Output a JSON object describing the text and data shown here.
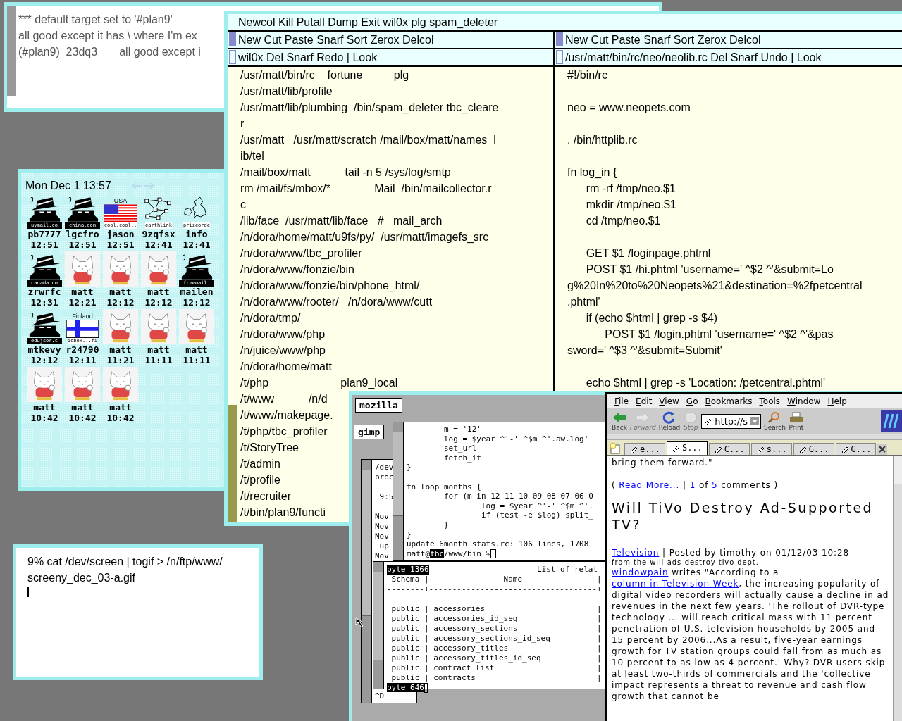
{
  "irc_window": {
    "lines": [
      "*** default target set to '#plan9'",
      "all good except it has \\ where I'm ex",
      "(#plan9)  23dq3       all good except i"
    ]
  },
  "faces_window": {
    "clock": "Mon Dec  1 13:57",
    "faces": [
      {
        "kind": "spy",
        "caption": "uymail.co",
        "name": "pb7777",
        "time": "12:51"
      },
      {
        "kind": "spy",
        "caption": "china.com",
        "name": "lgcfro",
        "time": "12:51"
      },
      {
        "kind": "flag_usa",
        "country": "USA",
        "caption": "cool.cool..",
        "name": "jason",
        "time": "12:51"
      },
      {
        "kind": "network",
        "caption": "earthlink",
        "name": "9zqfsx",
        "time": "12:41"
      },
      {
        "kind": "map",
        "caption": "prizeorde",
        "name": "info",
        "time": "12:41"
      },
      {
        "kind": "spy",
        "caption": "canada.co",
        "name": "zrwrfc",
        "time": "12:31"
      },
      {
        "kind": "cat",
        "name": "matt",
        "time": "12:21"
      },
      {
        "kind": "cat",
        "name": "matt",
        "time": "12:12"
      },
      {
        "kind": "cat",
        "name": "matt",
        "time": "12:12"
      },
      {
        "kind": "spy",
        "caption": "freemail.",
        "name": "mailen",
        "time": "12:12"
      },
      {
        "kind": "spy",
        "caption": "edujsor.c",
        "name": "mtkevy",
        "time": "12:12"
      },
      {
        "kind": "flag_finland",
        "country": "Finland",
        "caption": "iobox...fi",
        "name": "r24790",
        "time": "12:11"
      },
      {
        "kind": "cat",
        "name": "matt",
        "time": "11:21"
      },
      {
        "kind": "cat",
        "name": "matt",
        "time": "11:11"
      },
      {
        "kind": "cat",
        "name": "matt",
        "time": "11:11"
      },
      {
        "kind": "cat",
        "name": "matt",
        "time": "10:42"
      },
      {
        "kind": "cat",
        "name": "matt",
        "time": "10:42"
      },
      {
        "kind": "cat",
        "name": "matt",
        "time": "10:42"
      }
    ]
  },
  "rio_window": {
    "lines": [
      "9% cat /dev/screen | togif > /n/ftp/www/",
      "screeny_dec_03-a.gif"
    ]
  },
  "acme": {
    "tag": "Newcol Kill Putall Dump Exit wil0x plg spam_deleter",
    "columns": [
      {
        "tag": "New Cut Paste Snarf Sort Zerox Delcol",
        "window_tag": "wil0x Del Snarf Redo | Look",
        "blocks": [
          [
            "/usr/matt/bin/rc    fortune          plg",
            "/usr/matt/lib/profile",
            "/usr/matt/lib/plumbing  /bin/spam_deleter tbc_cleare",
            "r",
            "/usr/matt   /usr/matt/scratch /mail/box/matt/names  l",
            "ib/tel",
            "/mail/box/matt           tail -n 5 /sys/log/smtp",
            "rm /mail/fs/mbox/*              Mail  /bin/mailcollector.r",
            "c",
            "/lib/face  /usr/matt/lib/face   #   mail_arch",
            "/n/dora/home/matt/u9fs/py/  /usr/matt/imagefs_src",
            "/n/dora/www/tbc_profiler",
            "/n/dora/www/fonzie/bin",
            "/n/dora/www/fonzie/bin/phone_html/",
            "/n/dora/www/rooter/   /n/dora/www/cutt",
            "/n/dora/tmp/",
            "/n/dora/www/php",
            "/n/juice/www/php",
            "/n/dora/home/matt",
            "/t/php                       plan9_local",
            "/t/www           /n/d",
            "/t/www/makepage.",
            "/t/php/tbc_profiler",
            "/t/StoryTree",
            "/t/admin",
            "/t/profile",
            "/t/recruiter",
            "/t/bin/plan9/functi"
          ]
        ]
      },
      {
        "tag": "New Cut Paste Snarf Sort Zerox Delcol",
        "window_tag": "/usr/matt/bin/rc/neo/neolib.rc Del Snarf Undo | Look",
        "blocks": [
          [
            "#!/bin/rc"
          ],
          [
            "neo = www.neopets.com"
          ],
          [
            ". /bin/httplib.rc"
          ],
          [
            "fn log_in {",
            "\trm -rf /tmp/neo.$1",
            "\tmkdir /tmp/neo.$1",
            "\tcd /tmp/neo.$1"
          ],
          [
            "\tGET $1 /loginpage.phtml",
            "\tPOST $1 /hi.phtml 'username=' ^$2 ^'&submit=Lo",
            "g%20In%20to%20Neopets%21&destination=%2fpetcentral",
            ".phtml'",
            "\tif (echo $html | grep -s $4)",
            "\t\tPOST $1 /login.phtml 'username=' ^$2 ^'&pas",
            "sword=' ^$3 ^'&submit=Submit'"
          ],
          [
            "\techo $html | grep -s 'Location: /petcentral.phtml'"
          ]
        ]
      }
    ]
  },
  "x_desktop": {
    "icons": [
      {
        "label": "mozilla"
      },
      {
        "label": "gimp"
      }
    ],
    "back_xterm": {
      "blocks": [
        [
          "/dev",
          "proc"
        ],
        [
          " 9:5"
        ],
        [
          "Nov",
          "Nov",
          "Nov",
          " up",
          "Nov"
        ]
      ],
      "last_line": "^D"
    },
    "code_xterm": {
      "blocks": [
        [
          "\tm = '12'",
          "\tlog = $year ^'-' ^$m ^'.aw.log'",
          "\tset_url",
          "\tfetch_it",
          "}"
        ],
        [
          "fn loop_months {",
          "\tfor (m in 12 11 10 09 08 07 06 0",
          "\t\tlog = $year ^'-' ^$m ^'.",
          "\t\tif (test -e $log) split_",
          "\t}",
          "}",
          "update_6month_stats.rc: 106 lines, 1708"
        ]
      ],
      "prompt": [
        {
          "text": "matt@",
          "selected": false
        },
        {
          "text": "tbc",
          "selected": true
        },
        {
          "text": "/www/bin %",
          "selected": false
        }
      ]
    },
    "psql_xterm": {
      "status_top": "byte 1366",
      "title": "List of relat",
      "blocks": [
        [
          " Schema |                Name                |",
          "--------+------------------------------------+"
        ],
        [
          " public | accessories                        |",
          " public | accessories_id_seq                 |",
          " public | accessory_sections                 |",
          " public | accessory_sections_id_seq          |",
          " public | accessory_titles                   |",
          " public | accessory_titles_id_seq            |",
          " public | contract_list                      |",
          " public | contracts                          |"
        ]
      ],
      "status_bottom": "byte 646"
    },
    "browser": {
      "menu": [
        "File",
        "Edit",
        "View",
        "Go",
        "Bookmarks",
        "Tools",
        "Window",
        "Help"
      ],
      "nav_buttons": [
        {
          "kind": "back",
          "label": "Back",
          "disabled": false
        },
        {
          "kind": "forward",
          "label": "Forward",
          "disabled": true
        },
        {
          "kind": "reload",
          "label": "Reload",
          "disabled": false
        },
        {
          "kind": "stop",
          "label": "Stop",
          "disabled": true
        }
      ],
      "url": "http://s",
      "tool_buttons": [
        {
          "kind": "search",
          "label": "Search",
          "disabled": false
        },
        {
          "kind": "print",
          "label": "Print",
          "disabled": false
        }
      ],
      "tabs": [
        {
          "label": "e...",
          "selected": false
        },
        {
          "label": "S...",
          "selected": true
        },
        {
          "label": "C...",
          "selected": false
        },
        {
          "label": "s...",
          "selected": false
        },
        {
          "label": "G...",
          "selected": false
        },
        {
          "label": "G...",
          "selected": false
        }
      ],
      "content": {
        "lead": "bring them forward.\"",
        "links_line": [
          {
            "text": "( ",
            "link": false
          },
          {
            "text": "Read More...",
            "link": true
          },
          {
            "text": " | ",
            "link": false
          },
          {
            "text": "1",
            "link": true
          },
          {
            "text": " of ",
            "link": false
          },
          {
            "text": "5",
            "link": true
          },
          {
            "text": " comments )",
            "link": false
          }
        ],
        "title": "Will TiVo Destroy Ad-Supported TV?",
        "byline": [
          {
            "text": "Television",
            "link": true
          },
          {
            "text": " | Posted by timothy on 01/12/03 10:28",
            "link": false
          }
        ],
        "dept": "from the will-ads-destroy-tivo dept.",
        "body": [
          {
            "text": "windowpain",
            "link": true
          },
          {
            "text": " writes \"According to a ",
            "link": false
          },
          {
            "text": "column in Television Week",
            "link": true
          },
          {
            "text": ", the increasing popularity of digital video recorders will actually cause a decline in ad revenues in the next few years. 'The rollout of DVR-type technology ... will reach critical mass with 11 percent penetration of U.S. television households by 2005 and 15 percent by 2006...As a result, five-year earnings growth for TV station groups could fall from as much as 10 percent to as low as 4 percent.' Why? DVR users skip at least two-thirds of commercials and the 'collective impact represents a threat to revenue and cash flow growth that cannot be",
            "link": false
          }
        ]
      }
    }
  }
}
